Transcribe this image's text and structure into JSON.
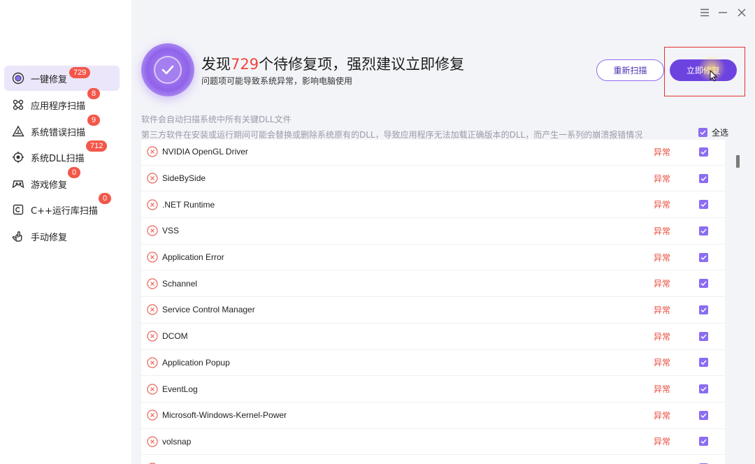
{
  "sidebar": {
    "items": [
      {
        "label": "一键修复",
        "badge": "729",
        "icon": "one-click-repair-icon"
      },
      {
        "label": "应用程序扫描",
        "badge": "8",
        "icon": "app-scan-icon"
      },
      {
        "label": "系统错误扫描",
        "badge": "9",
        "icon": "warning-triangle-icon"
      },
      {
        "label": "系统DLL扫描",
        "badge": "712",
        "icon": "dll-target-icon"
      },
      {
        "label": "游戏修复",
        "badge": "0",
        "icon": "gamepad-icon"
      },
      {
        "label": "C++运行库扫描",
        "badge": "0",
        "icon": "cpp-icon"
      },
      {
        "label": "手动修复",
        "icon": "manual-repair-icon"
      }
    ]
  },
  "header": {
    "headline_prefix": "发现",
    "issue_count": "729",
    "headline_suffix": "个待修复项，强烈建议立即修复",
    "subline": "问题项可能导致系统异常，影响电脑使用",
    "rescan_label": "重新扫描",
    "fix_label": "立即修复"
  },
  "info": {
    "line1": "软件会自动扫描系统中所有关键DLL文件",
    "line2": "第三方软件在安装或运行期间可能会替换或删除系统原有的DLL，导致应用程序无法加载正确版本的DLL，而产生一系列的崩溃报错情况",
    "select_all": "全选"
  },
  "status_label": "异常",
  "rows": [
    "NVIDIA OpenGL Driver",
    "SideBySide",
    ".NET Runtime",
    "VSS",
    "Application Error",
    "Schannel",
    "Service Control Manager",
    "DCOM",
    "Application Popup",
    "EventLog",
    "Microsoft-Windows-Kernel-Power",
    "volsnap",
    ""
  ],
  "colors": {
    "accent": "#6d43e0",
    "badge": "#f2574a",
    "error": "#e94b3c",
    "checkbox": "#8b6cf2"
  }
}
